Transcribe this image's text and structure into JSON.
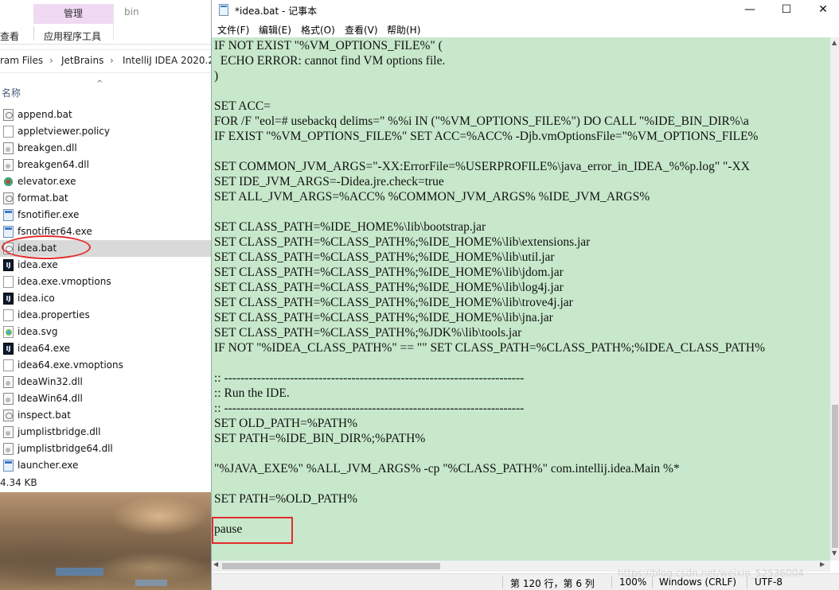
{
  "explorer": {
    "ribbon": {
      "manage_tab": "管理",
      "folder_name": "bin",
      "view_tab": "查看",
      "app_tools_tab": "应用程序工具"
    },
    "address": {
      "part1": "ram Files",
      "part2": "JetBrains",
      "part3": "IntelliJ IDEA 2020.2"
    },
    "column_name": "名称",
    "files": [
      {
        "name": "append.bat",
        "icon": "bat-file-icon"
      },
      {
        "name": "appletviewer.policy",
        "icon": "document-icon"
      },
      {
        "name": "breakgen.dll",
        "icon": "dll-file-icon"
      },
      {
        "name": "breakgen64.dll",
        "icon": "dll-file-icon"
      },
      {
        "name": "elevator.exe",
        "icon": "elevator-exe-icon"
      },
      {
        "name": "format.bat",
        "icon": "bat-file-icon"
      },
      {
        "name": "fsnotifier.exe",
        "icon": "exe-file-icon"
      },
      {
        "name": "fsnotifier64.exe",
        "icon": "exe-file-icon"
      },
      {
        "name": "idea.bat",
        "icon": "bat-file-icon",
        "selected": true
      },
      {
        "name": "idea.exe",
        "icon": "intellij-icon"
      },
      {
        "name": "idea.exe.vmoptions",
        "icon": "document-icon"
      },
      {
        "name": "idea.ico",
        "icon": "intellij-icon"
      },
      {
        "name": "idea.properties",
        "icon": "document-icon"
      },
      {
        "name": "idea.svg",
        "icon": "svg-file-icon"
      },
      {
        "name": "idea64.exe",
        "icon": "intellij-icon"
      },
      {
        "name": "idea64.exe.vmoptions",
        "icon": "document-icon"
      },
      {
        "name": "IdeaWin32.dll",
        "icon": "dll-file-icon"
      },
      {
        "name": "IdeaWin64.dll",
        "icon": "dll-file-icon"
      },
      {
        "name": "inspect.bat",
        "icon": "bat-file-icon"
      },
      {
        "name": "jumplistbridge.dll",
        "icon": "dll-file-icon"
      },
      {
        "name": "jumplistbridge64.dll",
        "icon": "dll-file-icon"
      },
      {
        "name": "launcher.exe",
        "icon": "exe-file-icon"
      }
    ],
    "status_size": "4.34 KB"
  },
  "notepad": {
    "title": "*idea.bat - 记事本",
    "buttons": {
      "minimize": "—",
      "maximize": "☐",
      "close": "✕"
    },
    "menu": [
      "文件(F)",
      "编辑(E)",
      "格式(O)",
      "查看(V)",
      "帮助(H)"
    ],
    "lines": [
      "IF NOT EXIST \"%VM_OPTIONS_FILE%\" (",
      "  ECHO ERROR: cannot find VM options file.",
      ")",
      "",
      "SET ACC=",
      "FOR /F \"eol=# usebackq delims=\" %%i IN (\"%VM_OPTIONS_FILE%\") DO CALL \"%IDE_BIN_DIR%\\a",
      "IF EXIST \"%VM_OPTIONS_FILE%\" SET ACC=%ACC% -Djb.vmOptionsFile=\"%VM_OPTIONS_FILE%",
      "",
      "SET COMMON_JVM_ARGS=\"-XX:ErrorFile=%USERPROFILE%\\java_error_in_IDEA_%%p.log\" \"-XX",
      "SET IDE_JVM_ARGS=-Didea.jre.check=true",
      "SET ALL_JVM_ARGS=%ACC% %COMMON_JVM_ARGS% %IDE_JVM_ARGS%",
      "",
      "SET CLASS_PATH=%IDE_HOME%\\lib\\bootstrap.jar",
      "SET CLASS_PATH=%CLASS_PATH%;%IDE_HOME%\\lib\\extensions.jar",
      "SET CLASS_PATH=%CLASS_PATH%;%IDE_HOME%\\lib\\util.jar",
      "SET CLASS_PATH=%CLASS_PATH%;%IDE_HOME%\\lib\\jdom.jar",
      "SET CLASS_PATH=%CLASS_PATH%;%IDE_HOME%\\lib\\log4j.jar",
      "SET CLASS_PATH=%CLASS_PATH%;%IDE_HOME%\\lib\\trove4j.jar",
      "SET CLASS_PATH=%CLASS_PATH%;%IDE_HOME%\\lib\\jna.jar",
      "SET CLASS_PATH=%CLASS_PATH%;%JDK%\\lib\\tools.jar",
      "IF NOT \"%IDEA_CLASS_PATH%\" == \"\" SET CLASS_PATH=%CLASS_PATH%;%IDEA_CLASS_PATH%",
      "",
      ":: -------------------------------------------------------------------------",
      ":: Run the IDE.",
      ":: -------------------------------------------------------------------------",
      "SET OLD_PATH=%PATH%",
      "SET PATH=%IDE_BIN_DIR%;%PATH%",
      "",
      "\"%JAVA_EXE%\" %ALL_JVM_ARGS% -cp \"%CLASS_PATH%\" com.intellij.idea.Main %*",
      "",
      "SET PATH=%OLD_PATH%",
      "",
      "pause"
    ],
    "status": {
      "position": "第 120 行，第 6 列",
      "zoom": "100%",
      "line_ending": "Windows (CRLF)",
      "encoding": "UTF-8"
    },
    "watermark": "https://blog.csdn.net/weixin_52536004"
  }
}
